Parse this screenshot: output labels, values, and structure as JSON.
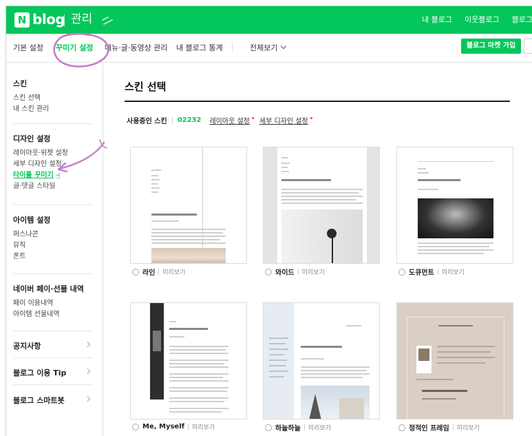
{
  "header": {
    "logo_letter": "N",
    "logo_text": "blog",
    "title": "관리",
    "links": [
      "내 블로그",
      "이웃블로그",
      "블로그"
    ]
  },
  "subnav": {
    "items": [
      "기본 설정",
      "꾸미기 설정",
      "메뉴·글·동영상 관리",
      "내 블로그 통계",
      "전체보기"
    ],
    "active_index": 1,
    "market_button": "블로그 마켓 가입"
  },
  "sidebar": {
    "sections": [
      {
        "title": "스킨",
        "items": [
          "스킨 선택",
          "내 스킨 관리"
        ]
      },
      {
        "title": "디자인 설정",
        "items": [
          "레이아웃·위젯 설정",
          "세부 디자인 설정",
          "타이틀 꾸미기",
          "글·댓글 스타일"
        ],
        "active": "타이틀 꾸미기"
      },
      {
        "title": "아이템 설정",
        "items": [
          "퍼스나콘",
          "뮤직",
          "폰트"
        ]
      },
      {
        "title": "네이버 페이·선물 내역",
        "items": [
          "페이 이용내역",
          "아이템 선물내역"
        ]
      }
    ],
    "links": [
      "공지사항",
      "블로그 이용 Tip",
      "블로그 스마트봇"
    ]
  },
  "main": {
    "title": "스킨 선택",
    "using_label": "사용중인 스킨",
    "skin_code": "02232",
    "layout_link": "레이아웃 설정",
    "detail_link": "세부 디자인 설정",
    "preview_label": "미리보기",
    "skins": [
      {
        "name": "라인"
      },
      {
        "name": "와이드"
      },
      {
        "name": "도큐먼트"
      },
      {
        "name": "Me, Myself"
      },
      {
        "name": "하늘하늘"
      },
      {
        "name": "정적인 프레임"
      }
    ]
  },
  "colors": {
    "brand": "#03c75a",
    "annotation": "#c77dc7"
  }
}
